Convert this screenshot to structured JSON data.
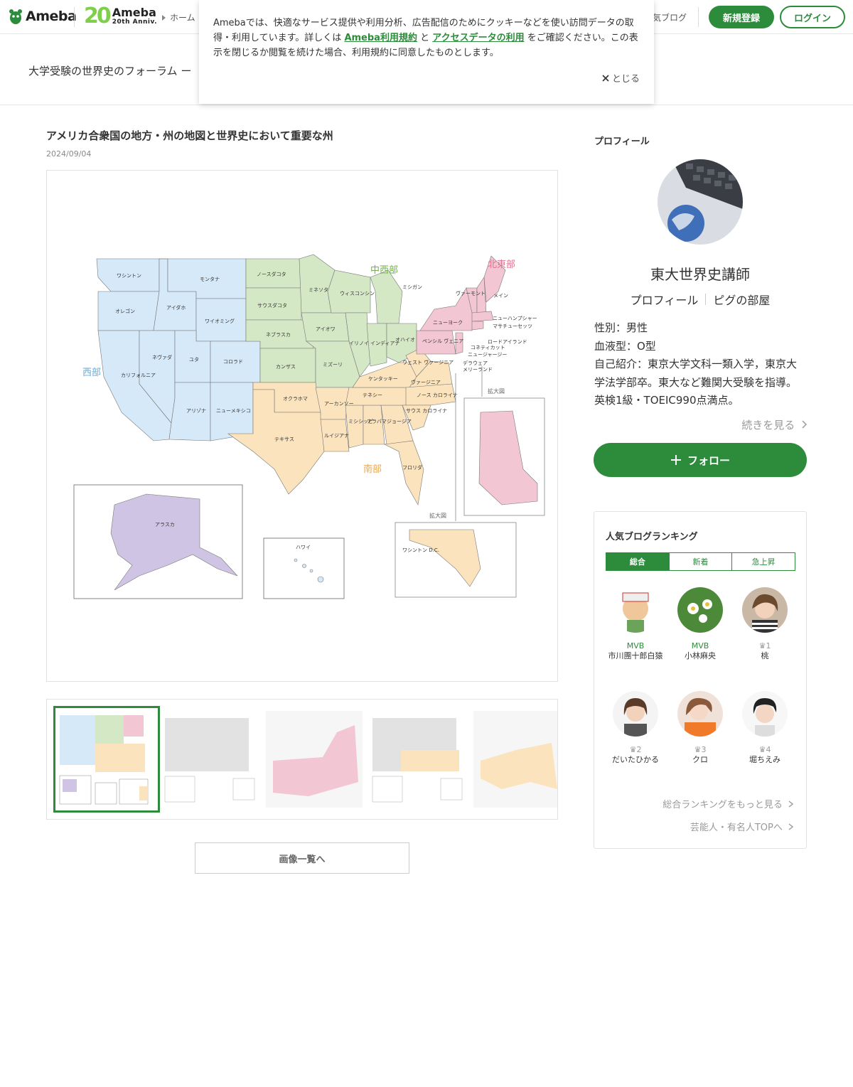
{
  "header": {
    "logo_text": "Ameba",
    "anniv_number": "20",
    "anniv_title": "Ameba",
    "anniv_sub": "20th Anniv.",
    "breadcrumb_home": "ホーム",
    "nav_blog": "気ブログ",
    "register": "新規登録",
    "login": "ログイン"
  },
  "cookie": {
    "text_before": "Amebaでは、快適なサービス提供や利用分析、広告配信のためにクッキーなどを使い訪問データの取得・利用しています。詳しくは ",
    "link1": "Ameba利用規約",
    "text_mid": " と ",
    "link2": "アクセスデータの利用",
    "text_after": " をご確認ください。この表示を閉じるか閲覧を続けた場合、利用規約に同意したものとします。",
    "close": "とじる"
  },
  "blog": {
    "title": "大学受験の世界史のフォーラム ー"
  },
  "entry": {
    "title": "アメリカ合衆国の地方・州の地図と世界史において重要な州",
    "date": "2024/09/04",
    "list_button": "画像一覧へ"
  },
  "map": {
    "regions": {
      "west": "西部",
      "midwest": "中西部",
      "northeast": "北東部",
      "south": "南部"
    },
    "colors": {
      "west": "#d6e9f8",
      "midwest": "#d5e8c6",
      "northeast": "#f3c6d3",
      "south": "#fbe3bd",
      "alaska": "#cfc4e3"
    },
    "states": {
      "washington": "ワシントン",
      "oregon": "オレゴン",
      "california": "カリフォルニア",
      "idaho": "アイダホ",
      "nevada": "ネヴァダ",
      "montana": "モンタナ",
      "wyoming": "ワイオミング",
      "utah": "ユタ",
      "colorado": "コロラド",
      "arizona": "アリゾナ",
      "newmexico": "ニューメキシコ",
      "northdakota": "ノースダコタ",
      "southdakota": "サウスダコタ",
      "nebraska": "ネブラスカ",
      "kansas": "カンザス",
      "minnesota": "ミネソタ",
      "iowa": "アイオワ",
      "missouri": "ミズーリ",
      "wisconsin": "ウィスコンシン",
      "illinois": "イリノイ",
      "michigan": "ミシガン",
      "indiana": "インディアナ",
      "ohio": "オハイオ",
      "oklahoma": "オクラホマ",
      "texas": "テキサス",
      "arkansas": "アーカンソー",
      "louisiana": "ルイジアナ",
      "mississippi": "ミシシッピ",
      "alabama": "アラバマ",
      "georgia": "ジョージア",
      "florida": "フロリダ",
      "tennessee": "テネシー",
      "kentucky": "ケンタッキー",
      "westvirginia": "ウェスト ヴァージニア",
      "virginia": "ヴァージニア",
      "northcarolina": "ノース カロライナ",
      "southcarolina": "サウス カロライナ",
      "newyork": "ニューヨーク",
      "pennsylvania": "ペンシル ヴェニア",
      "vermont": "ヴァーモント",
      "maine": "メイン",
      "newhampshire": "ニューハンプシャー",
      "massachusetts": "マサチューセッツ",
      "rhodeisland": "ロードアイランド",
      "connecticut": "コネティカット",
      "newjersey": "ニュージャージー",
      "delaware": "デラウェア",
      "maryland": "メリーランド",
      "alaska": "アラスカ",
      "hawaii": "ハワイ",
      "washingtondc": "ワシントン D.C."
    },
    "zoom_label": "拡大図"
  },
  "sidebar": {
    "profile_heading": "プロフィール",
    "author": "東大世界史講師",
    "link_profile": "プロフィール",
    "link_room": "ピグの部屋",
    "gender": "性別：男性",
    "blood": "血液型：O型",
    "intro": "自己紹介：東京大学文科一類入学，東京大学法学部卒。東大など難関大受験を指導。英検1級・TOEIC990点満点。",
    "more": "続きを見る",
    "follow": "フォロー"
  },
  "ranking": {
    "heading": "人気ブログランキング",
    "tabs": [
      "総合",
      "新着",
      "急上昇"
    ],
    "items": [
      {
        "badge": "MVB",
        "name": "市川團十郎白猿"
      },
      {
        "badge": "MVB",
        "name": "小林麻央"
      },
      {
        "badge": "1",
        "name": "桃"
      },
      {
        "badge": "2",
        "name": "だいたひかる"
      },
      {
        "badge": "3",
        "name": "クロ"
      },
      {
        "badge": "4",
        "name": "堀ちえみ"
      }
    ],
    "more_ranking": "総合ランキングをもっと見る",
    "more_celeb": "芸能人・有名人TOPへ"
  }
}
